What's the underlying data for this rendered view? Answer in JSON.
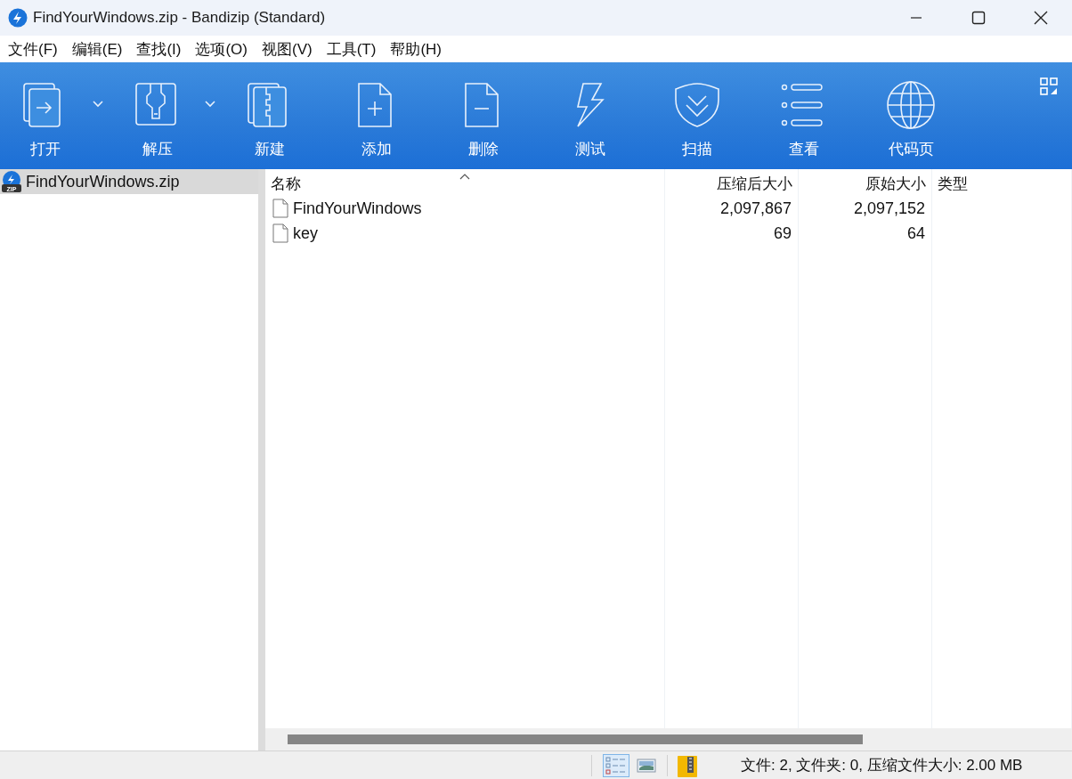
{
  "window": {
    "title": "FindYourWindows.zip - Bandizip (Standard)"
  },
  "menu": [
    "文件(F)",
    "编辑(E)",
    "查找(I)",
    "选项(O)",
    "视图(V)",
    "工具(T)",
    "帮助(H)"
  ],
  "toolbar": [
    {
      "kind": "open",
      "label": "打开",
      "dropdown": true
    },
    {
      "kind": "extract",
      "label": "解压",
      "dropdown": true
    },
    {
      "kind": "new",
      "label": "新建",
      "dropdown": false
    },
    {
      "kind": "add",
      "label": "添加",
      "dropdown": false
    },
    {
      "kind": "delete",
      "label": "删除",
      "dropdown": false
    },
    {
      "kind": "test",
      "label": "测试",
      "dropdown": false
    },
    {
      "kind": "scan",
      "label": "扫描",
      "dropdown": false
    },
    {
      "kind": "view",
      "label": "查看",
      "dropdown": false
    },
    {
      "kind": "codepage",
      "label": "代码页",
      "dropdown": false
    }
  ],
  "tree": [
    {
      "label": "FindYourWindows.zip",
      "icon_text": "ZIP",
      "selected": true
    }
  ],
  "table": {
    "columns": [
      {
        "label": "名称",
        "sorted": true
      },
      {
        "label": "压缩后大小",
        "sorted": false
      },
      {
        "label": "原始大小",
        "sorted": false
      },
      {
        "label": "类型",
        "sorted": false
      }
    ],
    "rows": [
      [
        "FindYourWindows",
        "2,097,867",
        "2,097,152"
      ],
      [
        "key",
        "69",
        "64"
      ]
    ]
  },
  "status_bar": {
    "views": [
      {
        "kind": "details",
        "selected": true
      },
      {
        "kind": "thumbnails",
        "selected": false
      }
    ],
    "text": "文件: 2, 文件夹: 0, 压缩文件大小: 2.00 MB"
  }
}
